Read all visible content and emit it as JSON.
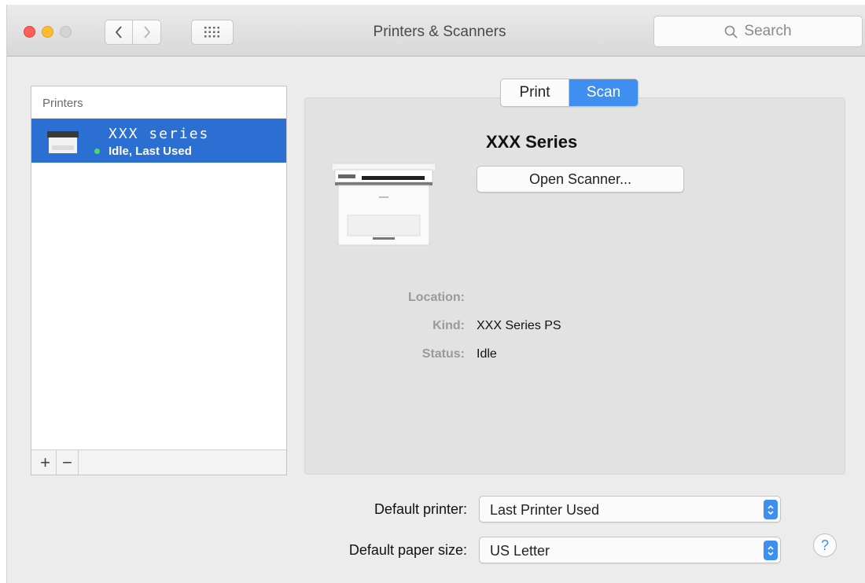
{
  "window": {
    "title": "Printers & Scanners",
    "search_placeholder": "Search"
  },
  "toolbar": {
    "back_icon": "chevron-left-icon",
    "forward_icon": "chevron-right-icon",
    "grid_icon": "grid-icon"
  },
  "printer_list": {
    "header": "Printers",
    "items": [
      {
        "name": "XXX series",
        "status": "Idle, Last Used",
        "status_color": "#4cd964"
      }
    ],
    "add_label": "+",
    "remove_label": "−"
  },
  "tabs": {
    "print_label": "Print",
    "scan_label": "Scan",
    "selected": "Scan"
  },
  "details": {
    "title": "XXX Series",
    "open_scanner_label": "Open Scanner...",
    "location_label": "Location:",
    "location_value": "",
    "kind_label": "Kind:",
    "kind_value": "XXX Series PS",
    "status_label": "Status:",
    "status_value": "Idle"
  },
  "defaults": {
    "printer_label": "Default printer:",
    "printer_value": "Last Printer Used",
    "paper_label": "Default paper size:",
    "paper_value": "US Letter"
  },
  "help_label": "?",
  "colors": {
    "accent": "#3f8ff0",
    "selection": "#2a6fd1"
  }
}
